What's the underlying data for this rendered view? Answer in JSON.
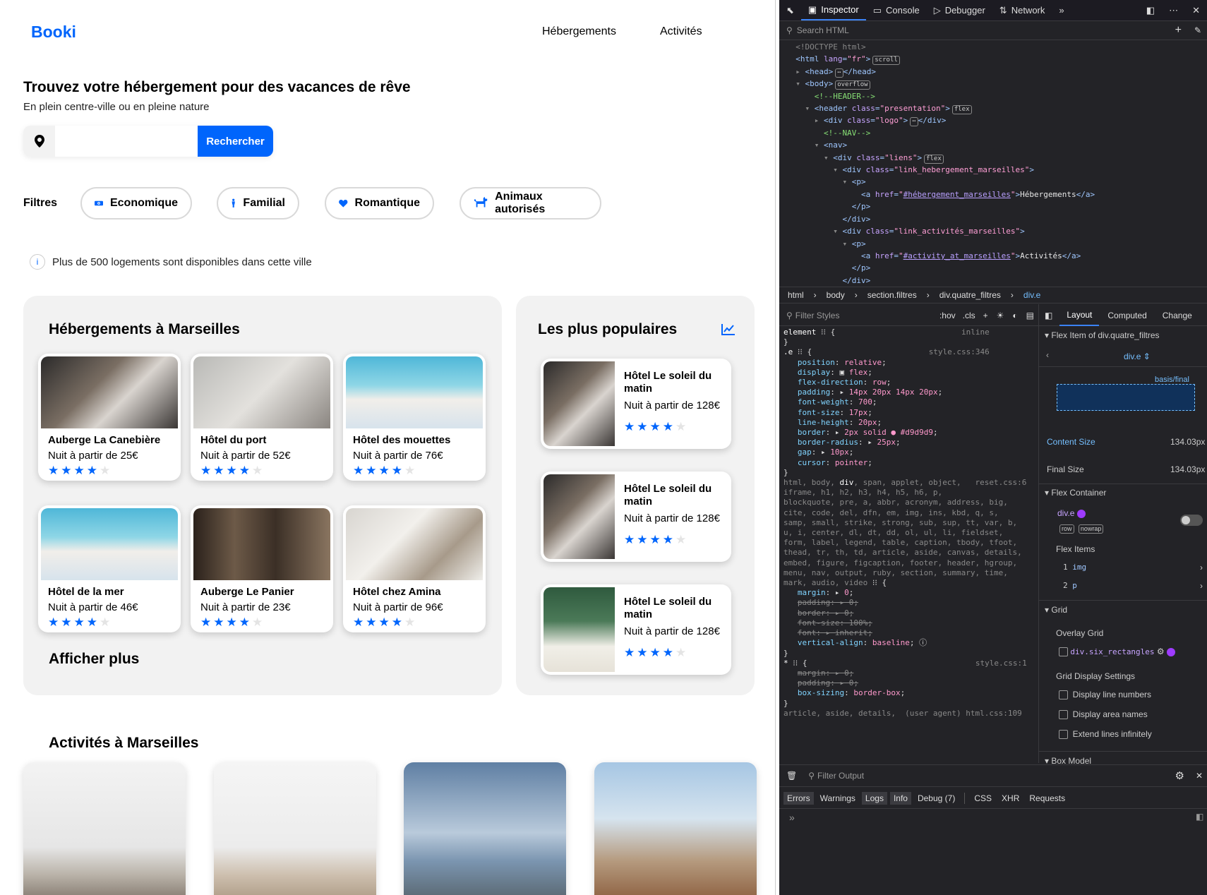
{
  "site": {
    "logo": "Booki",
    "nav": [
      "Hébergements",
      "Activités"
    ],
    "title": "Trouvez votre hébergement pour des vacances de rêve",
    "subtitle": "En plein centre-ville ou en pleine nature",
    "search_button": "Rechercher",
    "search_placeholder": "",
    "filters_label": "Filtres",
    "filters": [
      {
        "label": "Economique",
        "icon": "money-icon"
      },
      {
        "label": "Familial",
        "icon": "person-icon"
      },
      {
        "label": "Romantique",
        "icon": "heart-icon"
      },
      {
        "label": "Animaux autorisés",
        "icon": "dog-icon"
      }
    ],
    "info_text": "Plus de 500 logements sont disponibles dans cette ville",
    "hebergements_title": "Hébergements à Marseilles",
    "hebergements": [
      {
        "name": "Auberge La Canebière",
        "price": "Nuit à partir de 25€",
        "rating": 4
      },
      {
        "name": "Hôtel du port",
        "price": "Nuit à partir de 52€",
        "rating": 4
      },
      {
        "name": "Hôtel des mouettes",
        "price": "Nuit à partir de 76€",
        "rating": 4
      },
      {
        "name": "Hôtel de la mer",
        "price": "Nuit à partir de 46€",
        "rating": 4
      },
      {
        "name": "Auberge Le Panier",
        "price": "Nuit à partir de 23€",
        "rating": 4
      },
      {
        "name": "Hôtel chez Amina",
        "price": "Nuit à partir de 96€",
        "rating": 4
      }
    ],
    "show_more": "Afficher plus",
    "populaires_title": "Les plus populaires",
    "populaires": [
      {
        "name": "Hôtel Le soleil du matin",
        "price": "Nuit à partir de 128€",
        "rating": 4
      },
      {
        "name": "Hôtel Le soleil du matin",
        "price": "Nuit à partir de 128€",
        "rating": 4
      },
      {
        "name": "Hôtel Le soleil du matin",
        "price": "Nuit à partir de 128€",
        "rating": 4
      }
    ],
    "activites_title": "Activités à Marseilles",
    "accent": "#0065fc"
  },
  "devtools": {
    "tabs": [
      "Inspector",
      "Console",
      "Debugger",
      "Network"
    ],
    "search_html": "Search HTML",
    "breadcrumb": [
      "html",
      "body",
      "section.filtres",
      "div.quatre_filtres",
      "div.e"
    ],
    "filter_styles": "Filter Styles",
    "hov": ":hov",
    "cls": ".cls",
    "layout_tabs": [
      "Layout",
      "Computed",
      "Change"
    ],
    "flex_item_of": "Flex Item of div.quatre_filtres",
    "flex_selector": "div.e",
    "basis_final": "basis/final",
    "content_size_label": "Content Size",
    "content_size": "134.03px",
    "final_size_label": "Final Size",
    "final_size": "134.03px",
    "flex_container": "Flex Container",
    "container_el": "div.e",
    "row": "row",
    "nowrap": "nowrap",
    "flex_items": "Flex Items",
    "flex_item_1": "img",
    "flex_item_2": "p",
    "grid": "Grid",
    "overlay_grid": "Overlay Grid",
    "grid_el": "div.six_rectangles",
    "grid_display": "Grid Display Settings",
    "opt1": "Display line numbers",
    "opt2": "Display area names",
    "opt3": "Extend lines infinitely",
    "box_model": "Box Model",
    "filter_output": "Filter Output",
    "console_tabs": [
      "Errors",
      "Warnings",
      "Logs",
      "Info",
      "Debug (7)",
      "CSS",
      "XHR",
      "Requests"
    ]
  }
}
